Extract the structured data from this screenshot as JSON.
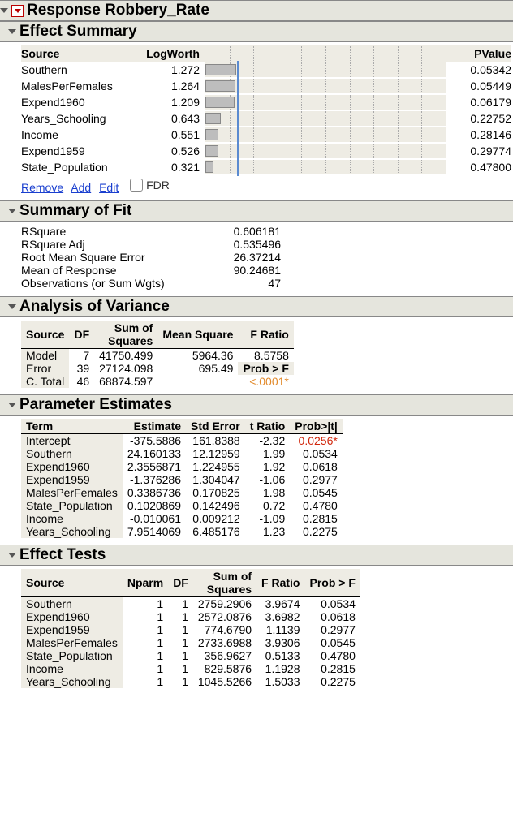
{
  "top": {
    "title": "Response Robbery_Rate"
  },
  "effect_summary": {
    "title": "Effect Summary",
    "headers": {
      "source": "Source",
      "logworth": "LogWorth",
      "pvalue": "PValue"
    },
    "refline": 1.301,
    "max": 10,
    "rows": [
      {
        "source": "Southern",
        "logworth": "1.272",
        "pvalue": "0.05342"
      },
      {
        "source": "MalesPerFemales",
        "logworth": "1.264",
        "pvalue": "0.05449"
      },
      {
        "source": "Expend1960",
        "logworth": "1.209",
        "pvalue": "0.06179"
      },
      {
        "source": "Years_Schooling",
        "logworth": "0.643",
        "pvalue": "0.22752"
      },
      {
        "source": "Income",
        "logworth": "0.551",
        "pvalue": "0.28146"
      },
      {
        "source": "Expend1959",
        "logworth": "0.526",
        "pvalue": "0.29774"
      },
      {
        "source": "State_Population",
        "logworth": "0.321",
        "pvalue": "0.47800"
      }
    ],
    "links": {
      "remove": "Remove",
      "add": "Add",
      "edit": "Edit",
      "fdr": "FDR"
    }
  },
  "summary_of_fit": {
    "title": "Summary of Fit",
    "rows": [
      {
        "label": "RSquare",
        "value": "0.606181"
      },
      {
        "label": "RSquare Adj",
        "value": "0.535496"
      },
      {
        "label": "Root Mean Square Error",
        "value": "26.37214"
      },
      {
        "label": "Mean of Response",
        "value": "90.24681"
      },
      {
        "label": "Observations (or Sum Wgts)",
        "value": "47"
      }
    ]
  },
  "anova": {
    "title": "Analysis of Variance",
    "headers": {
      "source": "Source",
      "df": "DF",
      "ss": "Sum of\nSquares",
      "ms": "Mean Square",
      "f": "F Ratio",
      "probf": "Prob > F"
    },
    "rows": [
      {
        "source": "Model",
        "df": "7",
        "ss": "41750.499",
        "ms": "5964.36",
        "f": "8.5758",
        "probf": ""
      },
      {
        "source": "Error",
        "df": "39",
        "ss": "27124.098",
        "ms": "695.49",
        "f_label": "Prob > F",
        "probf": ""
      },
      {
        "source": "C. Total",
        "df": "46",
        "ss": "68874.597",
        "ms": "",
        "f": "",
        "probf": "<.0001*"
      }
    ]
  },
  "param_est": {
    "title": "Parameter Estimates",
    "headers": {
      "term": "Term",
      "est": "Estimate",
      "se": "Std Error",
      "t": "t Ratio",
      "p": "Prob>|t|"
    },
    "rows": [
      {
        "term": "Intercept",
        "est": "-375.5886",
        "se": "161.8388",
        "t": "-2.32",
        "p": "0.0256*",
        "sig": "red"
      },
      {
        "term": "Southern",
        "est": "24.160133",
        "se": "12.12959",
        "t": "1.99",
        "p": "0.0534"
      },
      {
        "term": "Expend1960",
        "est": "2.3556871",
        "se": "1.224955",
        "t": "1.92",
        "p": "0.0618"
      },
      {
        "term": "Expend1959",
        "est": "-1.376286",
        "se": "1.304047",
        "t": "-1.06",
        "p": "0.2977"
      },
      {
        "term": "MalesPerFemales",
        "est": "0.3386736",
        "se": "0.170825",
        "t": "1.98",
        "p": "0.0545"
      },
      {
        "term": "State_Population",
        "est": "0.1020869",
        "se": "0.142496",
        "t": "0.72",
        "p": "0.4780"
      },
      {
        "term": "Income",
        "est": "-0.010061",
        "se": "0.009212",
        "t": "-1.09",
        "p": "0.2815"
      },
      {
        "term": "Years_Schooling",
        "est": "7.9514069",
        "se": "6.485176",
        "t": "1.23",
        "p": "0.2275"
      }
    ]
  },
  "effect_tests": {
    "title": "Effect Tests",
    "headers": {
      "source": "Source",
      "nparm": "Nparm",
      "df": "DF",
      "ss": "Sum of\nSquares",
      "f": "F Ratio",
      "p": "Prob > F"
    },
    "rows": [
      {
        "source": "Southern",
        "nparm": "1",
        "df": "1",
        "ss": "2759.2906",
        "f": "3.9674",
        "p": "0.0534"
      },
      {
        "source": "Expend1960",
        "nparm": "1",
        "df": "1",
        "ss": "2572.0876",
        "f": "3.6982",
        "p": "0.0618"
      },
      {
        "source": "Expend1959",
        "nparm": "1",
        "df": "1",
        "ss": "774.6790",
        "f": "1.1139",
        "p": "0.2977"
      },
      {
        "source": "MalesPerFemales",
        "nparm": "1",
        "df": "1",
        "ss": "2733.6988",
        "f": "3.9306",
        "p": "0.0545"
      },
      {
        "source": "State_Population",
        "nparm": "1",
        "df": "1",
        "ss": "356.9627",
        "f": "0.5133",
        "p": "0.4780"
      },
      {
        "source": "Income",
        "nparm": "1",
        "df": "1",
        "ss": "829.5876",
        "f": "1.1928",
        "p": "0.2815"
      },
      {
        "source": "Years_Schooling",
        "nparm": "1",
        "df": "1",
        "ss": "1045.5266",
        "f": "1.5033",
        "p": "0.2275"
      }
    ]
  }
}
